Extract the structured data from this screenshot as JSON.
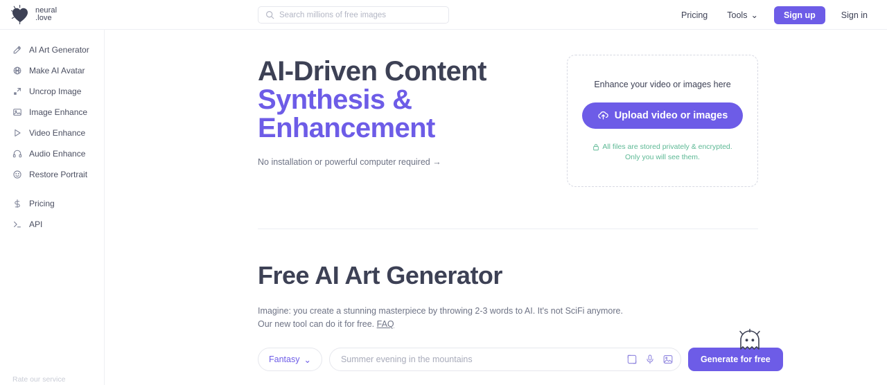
{
  "brand": {
    "logo_icon": "heart-sparkle-icon",
    "name_line1": "neural",
    "name_line2": ".love"
  },
  "header": {
    "search": {
      "icon": "search-icon",
      "placeholder": "Search millions of free images",
      "value": ""
    },
    "pricing_label": "Pricing",
    "tools_label": "Tools",
    "tools_chevron": "⌄",
    "signup_label": "Sign up",
    "signin_label": "Sign in"
  },
  "sidebar": {
    "items": [
      {
        "label": "AI Art Generator",
        "icon": "magic-wand-icon"
      },
      {
        "label": "Make AI Avatar",
        "icon": "avatar-globe-icon"
      },
      {
        "label": "Uncrop Image",
        "icon": "expand-arrows-icon"
      },
      {
        "label": "Image Enhance",
        "icon": "image-icon"
      },
      {
        "label": "Video Enhance",
        "icon": "play-triangle-icon"
      },
      {
        "label": "Audio Enhance",
        "icon": "headphones-icon"
      },
      {
        "label": "Restore Portrait",
        "icon": "smiley-face-icon"
      }
    ],
    "secondary": [
      {
        "label": "Pricing",
        "icon": "dollar-sign-icon"
      },
      {
        "label": "API",
        "icon": "terminal-prompt-icon"
      }
    ],
    "footer_note": "Rate our service"
  },
  "hero": {
    "title_dark": "AI-Driven Content",
    "title_purple_line1": "Synthesis &",
    "title_purple_line2": "Enhancement",
    "subtitle": "No installation or powerful computer required →"
  },
  "upload_card": {
    "title": "Enhance your video or images here",
    "button_label": "Upload video or images",
    "button_icon": "cloud-upload-icon",
    "privacy_icon": "lock-icon",
    "privacy_line1": "All files are stored privately & encrypted.",
    "privacy_line2": "Only you will see them."
  },
  "generator": {
    "heading": "Free AI Art Generator",
    "description_line1": "Imagine: you create a stunning masterpiece by throwing 2-3 words to AI. It's not SciFi anymore.",
    "description_line2_prefix": "Our new tool can do it for free. ",
    "faq_label": "FAQ",
    "style_value": "Fantasy",
    "style_chevron": "⌄",
    "prompt_placeholder": "Summer evening in the mountains",
    "prompt_value": "",
    "icons": [
      "aspect-ratio-icon",
      "microphone-icon",
      "image-upload-icon"
    ],
    "generate_label": "Generate for free",
    "mascot_icon": "ghost-mascot-icon"
  },
  "colors": {
    "accent_purple": "#6d5ce7",
    "text_dark": "#3d4155",
    "text_muted": "#6e7385",
    "privacy_green": "#5cb894",
    "border_light": "#e6e7ed"
  }
}
